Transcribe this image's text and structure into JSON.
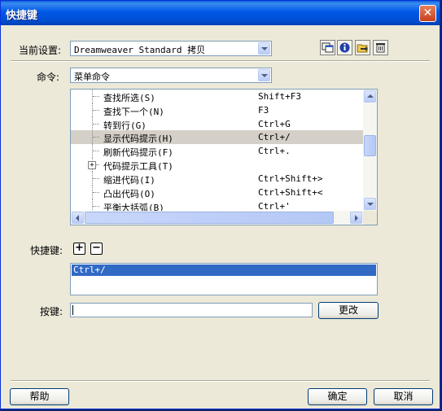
{
  "window": {
    "title": "快捷键",
    "close_glyph": "✕"
  },
  "current_set": {
    "label": "当前设置:",
    "value": "Dreamweaver Standard 拷贝"
  },
  "toolbar": {
    "icons": [
      "duplicate-set-icon",
      "info-icon",
      "export-icon",
      "delete-icon"
    ]
  },
  "commands": {
    "label": "命令:",
    "value": "菜单命令"
  },
  "tree": {
    "rows": [
      {
        "name": "查找所选(S)",
        "key": "Shift+F3",
        "selected": false,
        "expandable": false
      },
      {
        "name": "查找下一个(N)",
        "key": "F3",
        "selected": false,
        "expandable": false
      },
      {
        "name": "转到行(G)",
        "key": "Ctrl+G",
        "selected": false,
        "expandable": false
      },
      {
        "name": "显示代码提示(H)",
        "key": "Ctrl+/",
        "selected": true,
        "expandable": false
      },
      {
        "name": "刷新代码提示(F)",
        "key": "Ctrl+.",
        "selected": false,
        "expandable": false
      },
      {
        "name": "代码提示工具(T)",
        "key": "",
        "selected": false,
        "expandable": true
      },
      {
        "name": "缩进代码(I)",
        "key": "Ctrl+Shift+>",
        "selected": false,
        "expandable": false
      },
      {
        "name": "凸出代码(O)",
        "key": "Ctrl+Shift+<",
        "selected": false,
        "expandable": false
      },
      {
        "name": "平衡大括弧(B)",
        "key": "Ctrl+'",
        "selected": false,
        "expandable": false
      }
    ]
  },
  "shortcuts": {
    "label": "快捷键:",
    "add_glyph": "+",
    "remove_glyph": "−",
    "items": [
      "Ctrl+/"
    ]
  },
  "keypress": {
    "label": "按键:",
    "value": "",
    "change_label": "更改"
  },
  "footer": {
    "help_label": "帮助",
    "ok_label": "确定",
    "cancel_label": "取消"
  }
}
